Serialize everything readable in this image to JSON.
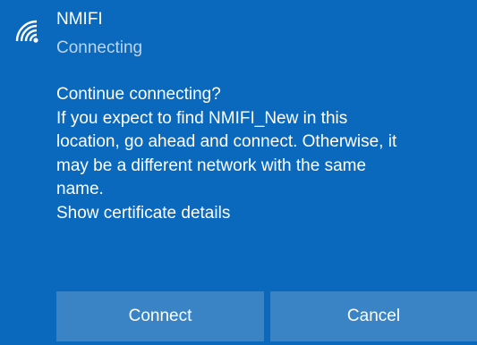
{
  "network": {
    "name": "NMIFI",
    "status": "Connecting",
    "icon": "wifi-signal-icon"
  },
  "message": {
    "question": "Continue connecting?",
    "body_lines": [
      "If you expect to find NMIFI_New in this",
      "location, go ahead and connect. Otherwise, it",
      "may be a different network with the same",
      "name."
    ],
    "certificate_link": "Show certificate details"
  },
  "buttons": {
    "connect_label": "Connect",
    "cancel_label": "Cancel"
  },
  "colors": {
    "background": "#0b69bd",
    "button": "#3a84c6",
    "secondary_text": "#bcd5ec"
  }
}
